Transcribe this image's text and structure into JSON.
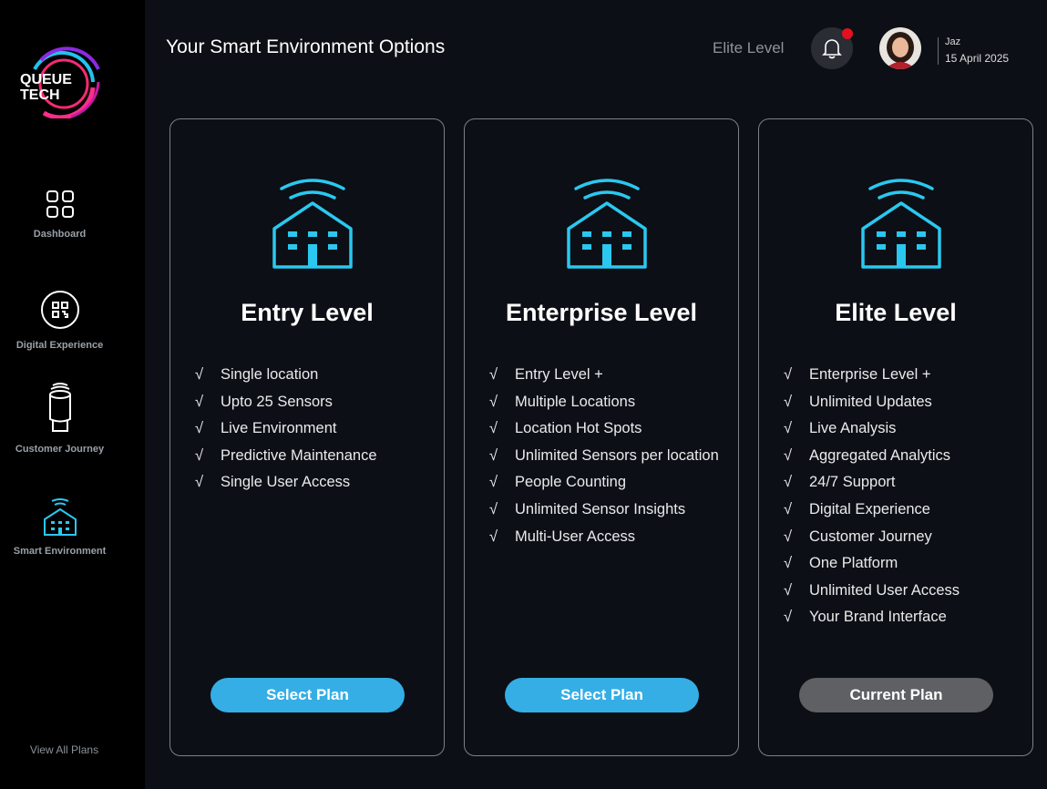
{
  "colors": {
    "accent": "#35aee6",
    "icon_cyan": "#2ac8f0",
    "sidebar_bg": "#000000",
    "page_bg": "#0c0f15",
    "notification_dot": "#e5101f",
    "current_plan_button": "#5e6063"
  },
  "logo": {
    "line1": "QUEUE",
    "line2": "TECH"
  },
  "sidebar": {
    "items": [
      {
        "label": "Dashboard",
        "icon": "grid-icon"
      },
      {
        "label": "Digital Experience",
        "icon": "qr-code-icon"
      },
      {
        "label": "Customer Journey",
        "icon": "sensor-device-icon"
      },
      {
        "label": "Smart Environment",
        "icon": "smart-building-icon",
        "active": true
      }
    ],
    "footer_link": "View All Plans"
  },
  "header": {
    "title": "Your Smart Environment Options",
    "current_level": "Elite Level",
    "notifications_icon": "bell-icon",
    "has_notification": true,
    "user": {
      "name": "Jaz",
      "date": "15 April 2025"
    }
  },
  "check_mark": "√",
  "plans": [
    {
      "name": "Entry Level",
      "icon": "smart-building-icon",
      "features": [
        "Single location",
        "Upto 25 Sensors",
        "Live Environment",
        "Predictive Maintenance",
        "Single User Access"
      ],
      "button_label": "Select Plan",
      "is_current": false
    },
    {
      "name": "Enterprise Level",
      "icon": "smart-building-icon",
      "features": [
        "Entry Level +",
        "Multiple Locations",
        "Location Hot Spots",
        "Unlimited Sensors per location",
        "People Counting",
        "Unlimited Sensor Insights",
        "Multi-User Access"
      ],
      "button_label": "Select Plan",
      "is_current": false
    },
    {
      "name": "Elite Level",
      "icon": "smart-building-icon",
      "features": [
        "Enterprise Level +",
        "Unlimited Updates",
        "Live Analysis",
        "Aggregated Analytics",
        "24/7 Support",
        "Digital Experience",
        "Customer Journey",
        "One Platform",
        "Unlimited User Access",
        "Your Brand Interface"
      ],
      "button_label": "Current Plan",
      "is_current": true
    }
  ]
}
